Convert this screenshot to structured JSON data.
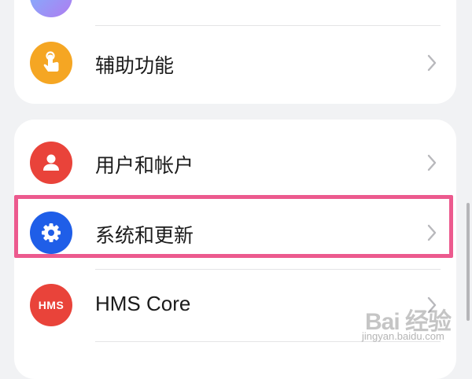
{
  "settings": {
    "items": [
      {
        "label": "辅助功能",
        "icon": "accessibility-icon",
        "color": "#f5a623"
      },
      {
        "label": "用户和帐户",
        "icon": "user-icon",
        "color": "#e9433a"
      },
      {
        "label": "系统和更新",
        "icon": "gear-icon",
        "color": "#1f5ee8"
      },
      {
        "label": "HMS Core",
        "icon": "hms-icon",
        "color": "#e9433a",
        "icon_text": "HMS"
      }
    ]
  },
  "watermark": {
    "logo": "Bai 经验",
    "url": "jingyan.baidu.com"
  },
  "colors": {
    "background": "#f1f2f4",
    "card": "#ffffff",
    "highlight": "#ec5a8e"
  }
}
